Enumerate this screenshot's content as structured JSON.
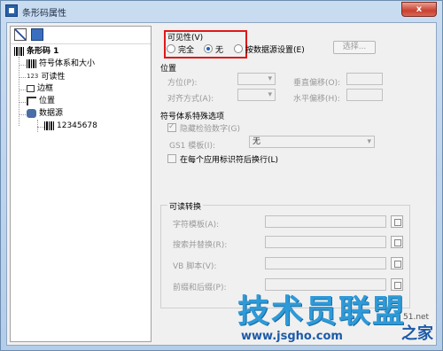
{
  "window": {
    "title": "条形码属性",
    "close_label": "x"
  },
  "tree": {
    "root": "条形码 1",
    "items": [
      "符号体系和大小",
      "可读性",
      "边框",
      "位置",
      "数据源"
    ],
    "readability_prefix": "123",
    "subitem": "12345678"
  },
  "visibility": {
    "heading": "可见性(V)",
    "option_full": "完全",
    "option_none": "无",
    "option_source": "按数据源设置(E)",
    "select_button": "选择..."
  },
  "position": {
    "heading": "位置",
    "orientation": "方位(P):",
    "alignment": "对齐方式(A):",
    "v_offset": "垂直偏移(O):",
    "h_offset": "水平偏移(H):"
  },
  "special": {
    "heading": "符号体系特殊选项",
    "hide_check_digit": "隐藏检验数字(G)",
    "gs1_template": "GS1 模板(I):",
    "gs1_value": "无",
    "newline_after_ai": "在每个应用标识符后换行(L)"
  },
  "readable": {
    "heading": "可读转换",
    "char_template": "字符模板(A):",
    "search_replace": "搜索并替换(R):",
    "vb_script": "VB 脚本(V):",
    "prefix_suffix": "前缀和后缀(P):"
  },
  "watermark": {
    "main": "技术员联盟",
    "url": "www.jsgho.com",
    "num": "51.net",
    "cn": "之家"
  }
}
